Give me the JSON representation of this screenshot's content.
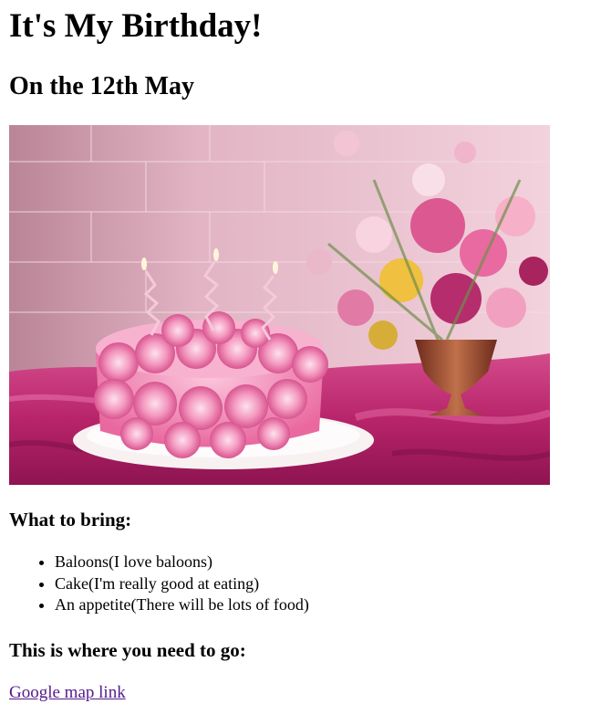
{
  "page": {
    "title": "It's My Birthday!",
    "subtitle": "On the 12th May"
  },
  "hero_image": {
    "alt": "",
    "colors": {
      "background": "#e9b9cb",
      "cake": "#f49ac0",
      "cloth": "#c2276f",
      "plate": "#f7f2f1"
    }
  },
  "bring": {
    "heading": "What to bring:",
    "items": [
      "Baloons(I love baloons)",
      "Cake(I'm really good at eating)",
      "An appetite(There will be lots of food)"
    ]
  },
  "location": {
    "heading": "This is where you need to go:",
    "link_text": "Google map link",
    "link_color": "#551a8b"
  }
}
